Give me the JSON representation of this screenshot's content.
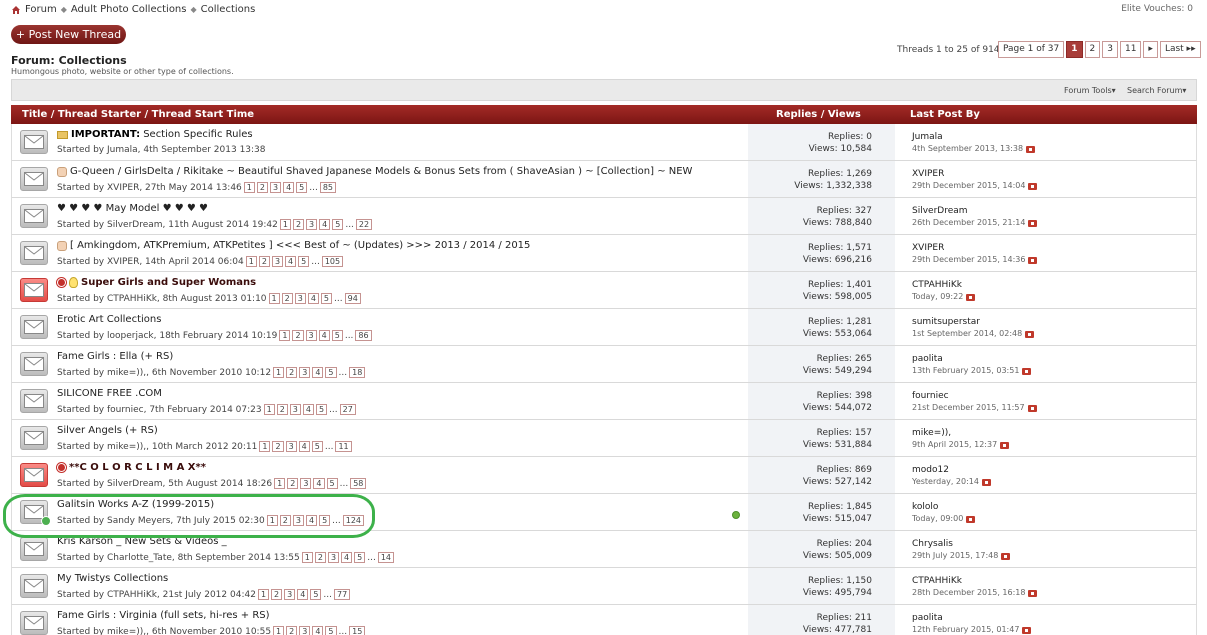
{
  "breadcrumb": {
    "items": [
      "Forum",
      "Adult Photo Collections",
      "Collections"
    ]
  },
  "vouches": "Elite Vouches: 0",
  "post_new_thread": "+ Post New Thread",
  "forum": {
    "title": "Forum: Collections",
    "description": "Humongous photo, website or other type of collections."
  },
  "threads_count": "Threads 1 to 25 of 914",
  "pager": {
    "page_label": "Page 1 of 37",
    "pages": [
      "1",
      "2",
      "3",
      "11"
    ],
    "next": "▸",
    "last": "Last ▸▸"
  },
  "tools": {
    "forum_tools": "Forum Tools▾",
    "search_forum": "Search Forum▾"
  },
  "columns": {
    "title": "Title / Thread Starter / Thread Start Time",
    "replies": "Replies / Views",
    "last_post": "Last Post By"
  },
  "threads": [
    {
      "prefix": "IMPORTANT:",
      "title": "Section Specific Rules",
      "started": "Started by Jumala, 4th September 2013 13:38",
      "pages": [],
      "last_page": "",
      "replies": "Replies: 0",
      "views": "Views: 10,584",
      "last_user": "Jumala",
      "last_date": "4th September 2013, 13:38",
      "icon": "folder",
      "hot": false
    },
    {
      "prefix": "",
      "title": "G-Queen / GirlsDelta / Rikitake ~ Beautiful Shaved Japanese Models & Bonus Sets from ( ShaveAsian ) ~ [Collection] ~ NEW",
      "started": "Started by XVIPER, 27th May 2014 13:46",
      "pages": [
        "1",
        "2",
        "3",
        "4",
        "5"
      ],
      "last_page": "85",
      "replies": "Replies: 1,269",
      "views": "Views: 1,332,338",
      "last_user": "XVIPER",
      "last_date": "29th December 2015, 14:04",
      "icon": "hand",
      "hot": false
    },
    {
      "prefix": "",
      "title": "♥ ♥ ♥ ♥ May Model ♥ ♥ ♥ ♥",
      "started": "Started by SilverDream, 11th August 2014 19:42",
      "pages": [
        "1",
        "2",
        "3",
        "4",
        "5"
      ],
      "last_page": "22",
      "replies": "Replies: 327",
      "views": "Views: 788,840",
      "last_user": "SilverDream",
      "last_date": "26th December 2015, 21:14",
      "icon": "",
      "hot": false
    },
    {
      "prefix": "",
      "title": "[ Amkingdom, ATKPremium, ATKPetites ] <<< Best of ~ (Updates) >>> 2013 / 2014 / 2015",
      "started": "Started by XVIPER, 14th April 2014 06:04",
      "pages": [
        "1",
        "2",
        "3",
        "4",
        "5"
      ],
      "last_page": "105",
      "replies": "Replies: 1,571",
      "views": "Views: 696,216",
      "last_user": "XVIPER",
      "last_date": "29th December 2015, 14:36",
      "icon": "hand",
      "hot": false
    },
    {
      "prefix": "",
      "title": "Super Girls and Super Womans",
      "started": "Started by CTPAHHiKk, 8th August 2013 01:10",
      "pages": [
        "1",
        "2",
        "3",
        "4",
        "5"
      ],
      "last_page": "94",
      "replies": "Replies: 1,401",
      "views": "Views: 598,005",
      "last_user": "CTPAHHiKk",
      "last_date": "Today, 09:22",
      "icon": "star-bulb",
      "hot": true
    },
    {
      "prefix": "",
      "title": "Erotic Art Collections",
      "started": "Started by looperjack, 18th February 2014 10:19",
      "pages": [
        "1",
        "2",
        "3",
        "4",
        "5"
      ],
      "last_page": "86",
      "replies": "Replies: 1,281",
      "views": "Views: 553,064",
      "last_user": "sumitsuperstar",
      "last_date": "1st September 2014, 02:48",
      "icon": "",
      "hot": false
    },
    {
      "prefix": "",
      "title": "Fame Girls : Ella (+ RS)",
      "started": "Started by mike=)),, 6th November 2010 10:12",
      "pages": [
        "1",
        "2",
        "3",
        "4",
        "5"
      ],
      "last_page": "18",
      "replies": "Replies: 265",
      "views": "Views: 549,294",
      "last_user": "paolita",
      "last_date": "13th February 2015, 03:51",
      "icon": "",
      "hot": false
    },
    {
      "prefix": "",
      "title": "SILICONE FREE .COM",
      "started": "Started by fourniec, 7th February 2014 07:23",
      "pages": [
        "1",
        "2",
        "3",
        "4",
        "5"
      ],
      "last_page": "27",
      "replies": "Replies: 398",
      "views": "Views: 544,072",
      "last_user": "fourniec",
      "last_date": "21st December 2015, 11:57",
      "icon": "",
      "hot": false
    },
    {
      "prefix": "",
      "title": "Silver Angels (+ RS)",
      "started": "Started by mike=)),, 10th March 2012 20:11",
      "pages": [
        "1",
        "2",
        "3",
        "4",
        "5"
      ],
      "last_page": "11",
      "replies": "Replies: 157",
      "views": "Views: 531,884",
      "last_user": "mike=)),",
      "last_date": "9th April 2015, 12:37",
      "icon": "",
      "hot": false
    },
    {
      "prefix": "",
      "title": "**C O L O R C L I M A X**",
      "started": "Started by SilverDream, 5th August 2014 18:26",
      "pages": [
        "1",
        "2",
        "3",
        "4",
        "5"
      ],
      "last_page": "58",
      "replies": "Replies: 869",
      "views": "Views: 527,142",
      "last_user": "modo12",
      "last_date": "Yesterday, 20:14",
      "icon": "star",
      "hot": true
    },
    {
      "prefix": "",
      "title": "Galitsin Works A-Z (1999-2015)",
      "started": "Started by Sandy Meyers, 7th July 2015 02:30",
      "pages": [
        "1",
        "2",
        "3",
        "4",
        "5"
      ],
      "last_page": "124",
      "replies": "Replies: 1,845",
      "views": "Views: 515,047",
      "last_user": "kololo",
      "last_date": "Today, 09:00",
      "icon": "",
      "hot": false,
      "subscribed": true
    },
    {
      "prefix": "",
      "title": "Kris Karson _ New Sets & Videos _",
      "started": "Started by Charlotte_Tate, 8th September 2014 13:55",
      "pages": [
        "1",
        "2",
        "3",
        "4",
        "5"
      ],
      "last_page": "14",
      "replies": "Replies: 204",
      "views": "Views: 505,009",
      "last_user": "Chrysalis",
      "last_date": "29th July 2015, 17:48",
      "icon": "",
      "hot": false
    },
    {
      "prefix": "",
      "title": "My Twistys Collections",
      "started": "Started by CTPAHHiKk, 21st July 2012 04:42",
      "pages": [
        "1",
        "2",
        "3",
        "4",
        "5"
      ],
      "last_page": "77",
      "replies": "Replies: 1,150",
      "views": "Views: 495,794",
      "last_user": "CTPAHHiKk",
      "last_date": "28th December 2015, 16:18",
      "icon": "",
      "hot": false
    },
    {
      "prefix": "",
      "title": "Fame Girls : Virginia (full sets, hi-res + RS)",
      "started": "Started by mike=)),, 6th November 2010 10:55",
      "pages": [
        "1",
        "2",
        "3",
        "4",
        "5"
      ],
      "last_page": "15",
      "replies": "Replies: 211",
      "views": "Views: 477,781",
      "last_user": "paolita",
      "last_date": "12th February 2015, 01:47",
      "icon": "",
      "hot": false
    }
  ]
}
